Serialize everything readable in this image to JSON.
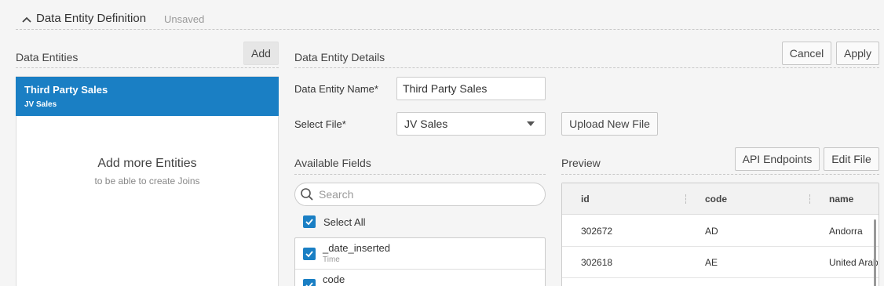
{
  "header": {
    "title": "Data Entity Definition",
    "status": "Unsaved"
  },
  "entities_panel": {
    "title": "Data Entities",
    "add_label": "Add",
    "items": [
      {
        "name": "Third Party Sales",
        "sub": "JV Sales",
        "selected": true
      }
    ],
    "empty_title": "Add more Entities",
    "empty_sub": "to be able to create Joins"
  },
  "details": {
    "title": "Data Entity Details",
    "cancel_label": "Cancel",
    "apply_label": "Apply",
    "name_label": "Data Entity Name*",
    "name_value": "Third Party Sales",
    "file_label": "Select File*",
    "file_value": "JV Sales",
    "upload_label": "Upload New File"
  },
  "available_fields": {
    "title": "Available Fields",
    "search_placeholder": "Search",
    "select_all_label": "Select All",
    "fields": [
      {
        "name": "_date_inserted",
        "type": "Time",
        "checked": true
      },
      {
        "name": "code",
        "type": "",
        "checked": true
      }
    ]
  },
  "preview": {
    "title": "Preview",
    "api_label": "API Endpoints",
    "edit_label": "Edit File",
    "columns": [
      "id",
      "code",
      "name"
    ],
    "rows": [
      [
        "302672",
        "AD",
        "Andorra"
      ],
      [
        "302618",
        "AE",
        "United Arab"
      ]
    ]
  },
  "colors": {
    "accent": "#1a7fc4",
    "background": "#f5f5f5"
  }
}
